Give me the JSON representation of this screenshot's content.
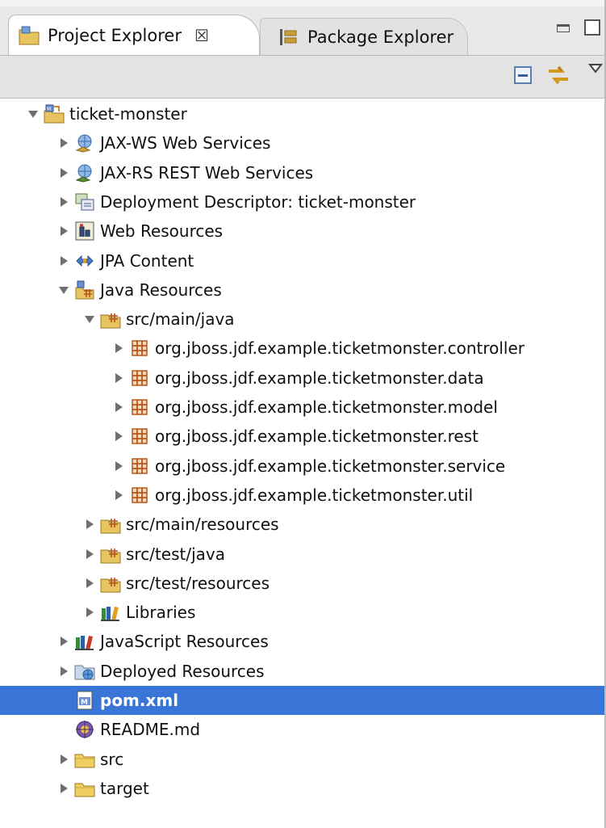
{
  "tabs": {
    "project_explorer": "Project Explorer",
    "close_glyph": "☒",
    "package_explorer": "Package Explorer"
  },
  "tree": [
    {
      "label": "ticket-monster",
      "depth": 0,
      "expander": "expanded",
      "icon": "project-icon"
    },
    {
      "label": "JAX-WS Web Services",
      "depth": 1,
      "expander": "collapsed",
      "icon": "web-service-icon"
    },
    {
      "label": "JAX-RS REST Web Services",
      "depth": 1,
      "expander": "collapsed",
      "icon": "rest-service-icon"
    },
    {
      "label": "Deployment Descriptor: ticket-monster",
      "depth": 1,
      "expander": "collapsed",
      "icon": "deployment-descriptor-icon"
    },
    {
      "label": "Web Resources",
      "depth": 1,
      "expander": "collapsed",
      "icon": "web-resources-icon"
    },
    {
      "label": "JPA Content",
      "depth": 1,
      "expander": "collapsed",
      "icon": "jpa-icon"
    },
    {
      "label": "Java Resources",
      "depth": 1,
      "expander": "expanded",
      "icon": "java-resources-icon"
    },
    {
      "label": "src/main/java",
      "depth": 2,
      "expander": "expanded",
      "icon": "source-folder-icon"
    },
    {
      "label": "org.jboss.jdf.example.ticketmonster.controller",
      "depth": 3,
      "expander": "collapsed",
      "icon": "package-icon"
    },
    {
      "label": "org.jboss.jdf.example.ticketmonster.data",
      "depth": 3,
      "expander": "collapsed",
      "icon": "package-icon"
    },
    {
      "label": "org.jboss.jdf.example.ticketmonster.model",
      "depth": 3,
      "expander": "collapsed",
      "icon": "package-icon"
    },
    {
      "label": "org.jboss.jdf.example.ticketmonster.rest",
      "depth": 3,
      "expander": "collapsed",
      "icon": "package-icon"
    },
    {
      "label": "org.jboss.jdf.example.ticketmonster.service",
      "depth": 3,
      "expander": "collapsed",
      "icon": "package-icon"
    },
    {
      "label": "org.jboss.jdf.example.ticketmonster.util",
      "depth": 3,
      "expander": "collapsed",
      "icon": "package-icon"
    },
    {
      "label": "src/main/resources",
      "depth": 2,
      "expander": "collapsed",
      "icon": "source-folder-icon"
    },
    {
      "label": "src/test/java",
      "depth": 2,
      "expander": "collapsed",
      "icon": "source-folder-icon"
    },
    {
      "label": "src/test/resources",
      "depth": 2,
      "expander": "collapsed",
      "icon": "source-folder-icon"
    },
    {
      "label": "Libraries",
      "depth": 2,
      "expander": "collapsed",
      "icon": "libraries-icon"
    },
    {
      "label": "JavaScript Resources",
      "depth": 1,
      "expander": "collapsed",
      "icon": "javascript-resources-icon"
    },
    {
      "label": "Deployed Resources",
      "depth": 1,
      "expander": "collapsed",
      "icon": "deployed-resources-icon"
    },
    {
      "label": "pom.xml",
      "depth": 1,
      "expander": "none",
      "icon": "maven-pom-icon",
      "selected": true
    },
    {
      "label": "README.md",
      "depth": 1,
      "expander": "none",
      "icon": "markdown-file-icon"
    },
    {
      "label": "src",
      "depth": 1,
      "expander": "collapsed",
      "icon": "folder-icon"
    },
    {
      "label": "target",
      "depth": 1,
      "expander": "collapsed",
      "icon": "folder-icon"
    }
  ],
  "colors": {
    "selection": "#3875d7",
    "package": "#b5561c",
    "folder": "#e0b43c"
  }
}
